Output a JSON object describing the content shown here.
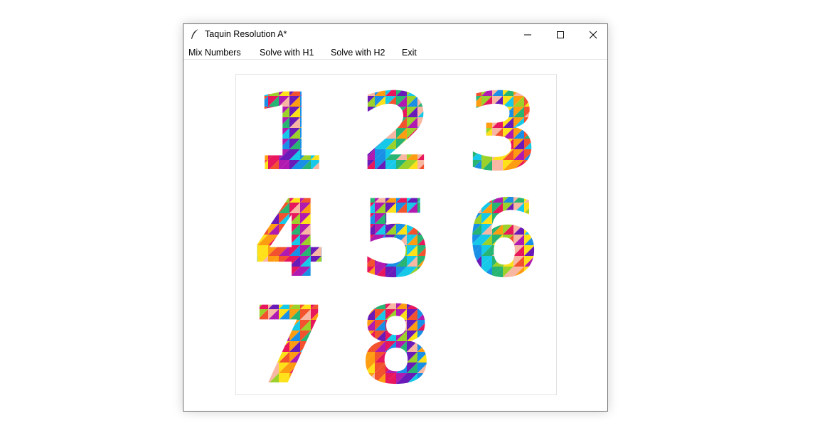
{
  "window": {
    "title": "Taquin Resolution A*",
    "app_icon": "feather-icon",
    "controls": [
      "minimize-icon",
      "maximize-icon",
      "close-icon"
    ]
  },
  "menu": {
    "items": [
      {
        "label": "Mix Numbers"
      },
      {
        "label": "Solve with H1"
      },
      {
        "label": "Solve with H2"
      },
      {
        "label": "Exit"
      }
    ]
  },
  "board": {
    "rows": 3,
    "cols": 3,
    "tiles": [
      "1",
      "2",
      "3",
      "4",
      "5",
      "6",
      "7",
      "8",
      ""
    ],
    "empty_tile_index": 8,
    "tile_style": "multicolor low-poly digits",
    "palette": [
      "#ffe11a",
      "#ff9d12",
      "#f2522e",
      "#e8175d",
      "#b01ab0",
      "#6a1ab8",
      "#1a8fe6",
      "#17c9e8",
      "#28b473",
      "#9bd12a",
      "#f7b7a3"
    ]
  }
}
